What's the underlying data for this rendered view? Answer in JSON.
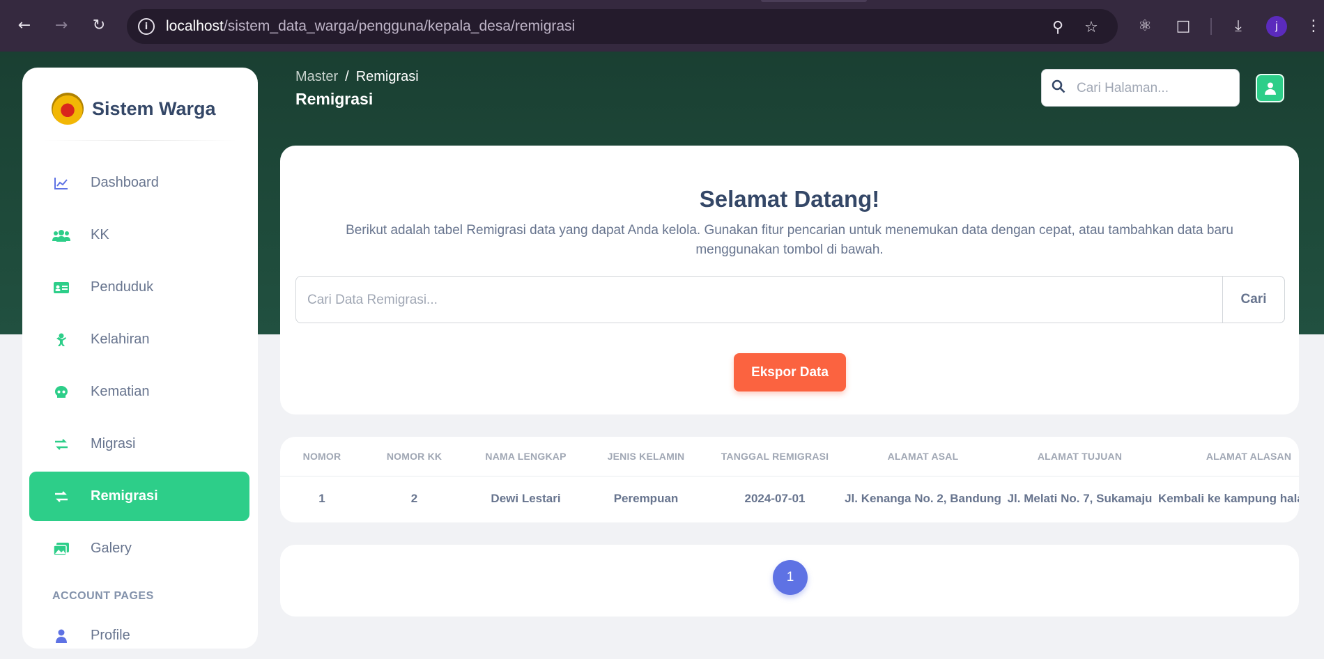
{
  "browser": {
    "url_host": "localhost",
    "url_path": "/sistem_data_warga/pengguna/kepala_desa/remigrasi",
    "profile_initial": "j"
  },
  "app": {
    "brand": "Sistem Warga"
  },
  "sidebar": {
    "items": [
      {
        "label": "Dashboard",
        "icon": "chart-icon"
      },
      {
        "label": "KK",
        "icon": "users-icon"
      },
      {
        "label": "Penduduk",
        "icon": "id-card-icon"
      },
      {
        "label": "Kelahiran",
        "icon": "baby-icon"
      },
      {
        "label": "Kematian",
        "icon": "skull-icon"
      },
      {
        "label": "Migrasi",
        "icon": "exchange-icon"
      },
      {
        "label": "Remigrasi",
        "icon": "exchange-icon",
        "active": true
      },
      {
        "label": "Galery",
        "icon": "images-icon"
      }
    ],
    "section_label": "ACCOUNT PAGES",
    "account_items": [
      {
        "label": "Profile",
        "icon": "user-icon"
      }
    ]
  },
  "header": {
    "breadcrumb_parent": "Master",
    "breadcrumb_sep": "/",
    "breadcrumb_current": "Remigrasi",
    "title": "Remigrasi",
    "search_placeholder": "Cari Halaman..."
  },
  "welcome": {
    "heading": "Selamat Datang!",
    "text": "Berikut adalah tabel Remigrasi data yang dapat Anda kelola. Gunakan fitur pencarian untuk menemukan data dengan cepat, atau tambahkan data baru menggunakan tombol di bawah.",
    "search_placeholder": "Cari Data Remigrasi...",
    "search_button": "Cari",
    "export_button": "Ekspor Data"
  },
  "table": {
    "columns": [
      "Nomor",
      "Nomor KK",
      "Nama Lengkap",
      "Jenis Kelamin",
      "Tanggal Remigrasi",
      "Alamat Asal",
      "Alamat Tujuan",
      "Alamat Alasan"
    ],
    "rows": [
      [
        "1",
        "2",
        "Dewi Lestari",
        "Perempuan",
        "2024-07-01",
        "Jl. Kenanga No. 2, Bandung",
        "Jl. Melati No. 7, Sukamaju",
        "Kembali ke kampung halaman"
      ]
    ]
  },
  "pagination": {
    "current": "1"
  },
  "colors": {
    "accent_green": "#2dce89",
    "export_orange": "#fb6340",
    "page_blue": "#5e72e4",
    "hero_dark_green": "#1e4a3a"
  }
}
